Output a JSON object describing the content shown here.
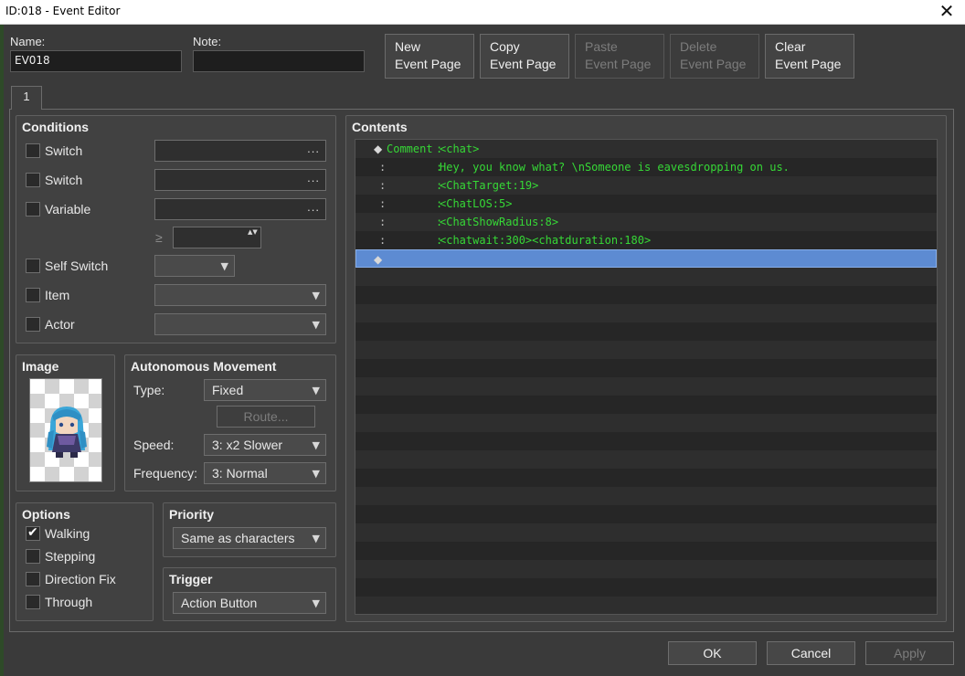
{
  "window": {
    "title": "ID:018 - Event Editor",
    "close_glyph": "✕"
  },
  "header": {
    "name_label": "Name:",
    "name_value": "EV018",
    "note_label": "Note:",
    "note_value": "",
    "buttons": [
      {
        "line1": "New",
        "line2": "Event Page",
        "enabled": true
      },
      {
        "line1": "Copy",
        "line2": "Event Page",
        "enabled": true
      },
      {
        "line1": "Paste",
        "line2": "Event Page",
        "enabled": false
      },
      {
        "line1": "Delete",
        "line2": "Event Page",
        "enabled": false
      },
      {
        "line1": "Clear",
        "line2": "Event Page",
        "enabled": true
      }
    ]
  },
  "tabs": [
    {
      "label": "1"
    }
  ],
  "conditions": {
    "title": "Conditions",
    "switch1": "Switch",
    "switch2": "Switch",
    "variable": "Variable",
    "gte_symbol": "≥",
    "self_switch": "Self Switch",
    "item": "Item",
    "actor": "Actor",
    "dots": "...",
    "arrow": "▼",
    "spin": "▲▼"
  },
  "image": {
    "title": "Image",
    "icon": "character-sprite-icon"
  },
  "movement": {
    "title": "Autonomous Movement",
    "type_label": "Type:",
    "type_value": "Fixed",
    "route_label": "Route...",
    "speed_label": "Speed:",
    "speed_value": "3: x2 Slower",
    "frequency_label": "Frequency:",
    "frequency_value": "3: Normal"
  },
  "options": {
    "title": "Options",
    "walking": "Walking",
    "stepping": "Stepping",
    "direction_fix": "Direction Fix",
    "through": "Through",
    "walking_checked": true
  },
  "priority": {
    "title": "Priority",
    "value": "Same as characters"
  },
  "trigger": {
    "title": "Trigger",
    "value": "Action Button"
  },
  "contents": {
    "title": "Contents",
    "diamond": "◆",
    "colon": ":",
    "comment_cmd": "Comment",
    "lines": [
      "<chat>",
      "Hey, you know what? \\nSomeone is eavesdropping on us.",
      "<ChatTarget:19>",
      "<ChatLOS:5>",
      "<ChatShowRadius:8>",
      "<chatwait:300><chatduration:180>"
    ]
  },
  "footer": {
    "ok": "OK",
    "cancel": "Cancel",
    "apply": "Apply"
  },
  "colors": {
    "accent_selected_row": "#5d8bd2",
    "command_text": "#36d836"
  }
}
